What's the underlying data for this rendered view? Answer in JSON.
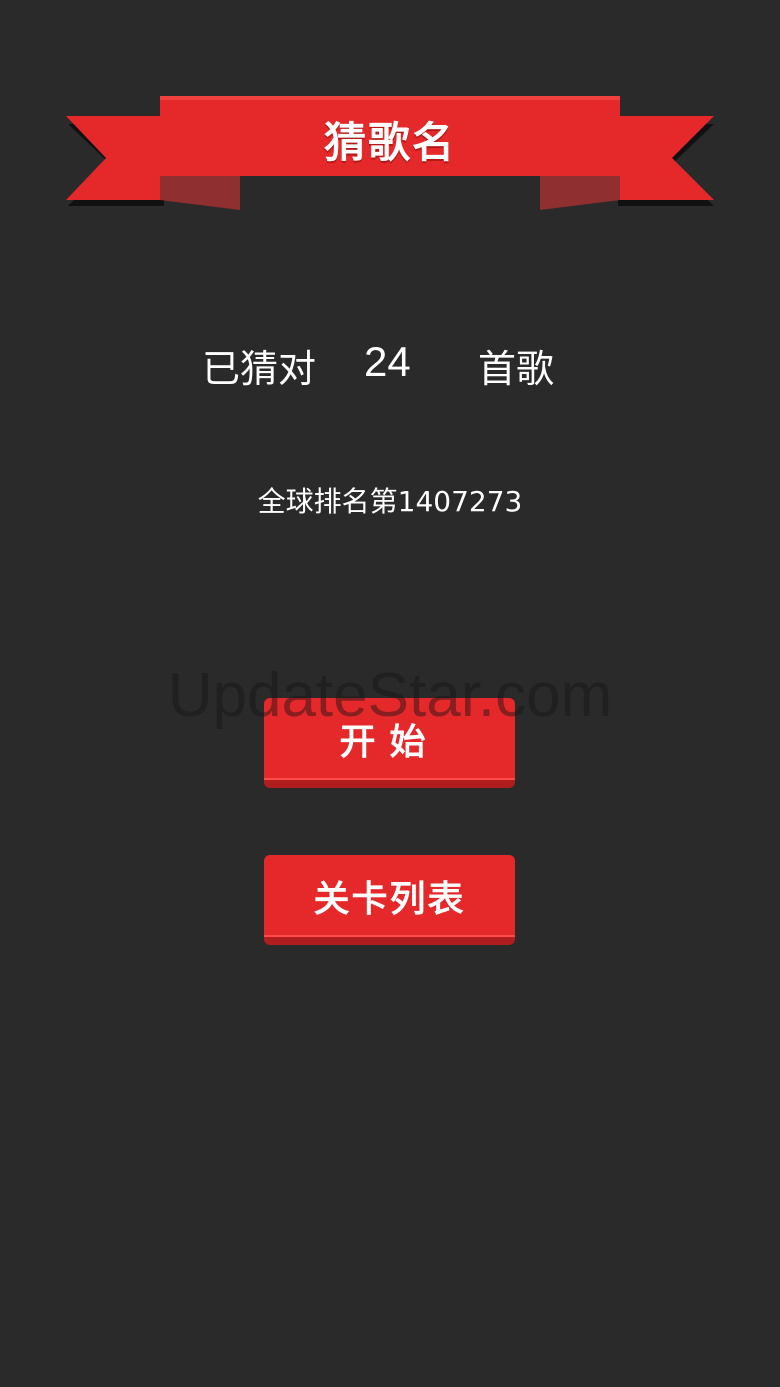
{
  "banner": {
    "title": "猜歌名",
    "color": "#e5292a"
  },
  "stats": {
    "prefix": "已猜对",
    "count": "24",
    "suffix": "首歌"
  },
  "rank": {
    "text": "全球排名第1407273"
  },
  "buttons": {
    "start": "开始",
    "levels": "关卡列表"
  },
  "watermark": {
    "text": "UpdateStar.com"
  },
  "colors": {
    "background": "#2a2a2a",
    "accent": "#e5292a",
    "accent_dark": "#b01d1f"
  }
}
